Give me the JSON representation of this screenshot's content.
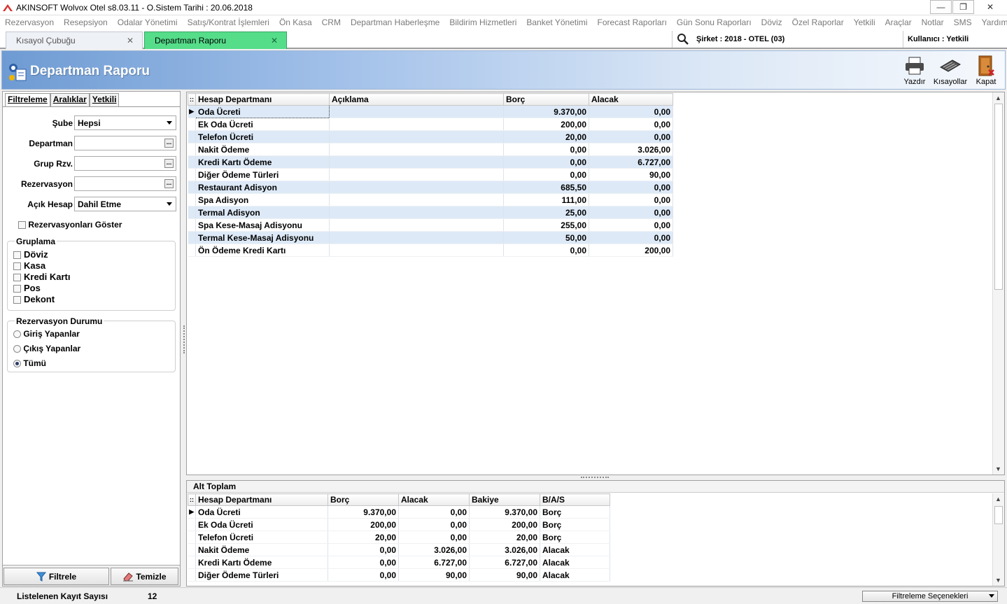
{
  "window": {
    "title": "AKINSOFT Wolvox Otel s8.03.11 - O.Sistem Tarihi : 20.06.2018",
    "minimize": "—",
    "maximize": "❐",
    "close": "✕"
  },
  "menu": [
    "Rezervasyon",
    "Resepsiyon",
    "Odalar Yönetimi",
    "Satış/Kontrat İşlemleri",
    "Ön Kasa",
    "CRM",
    "Departman Haberleşme",
    "Bildirim Hizmetleri",
    "Banket Yönetimi",
    "Forecast Raporları",
    "Gün Sonu Raporları",
    "Döviz",
    "Özel Raporlar",
    "Yetkili",
    "Araçlar",
    "Notlar",
    "SMS",
    "Yardım"
  ],
  "tabs": [
    {
      "label": "Kısayol Çubuğu",
      "active": false
    },
    {
      "label": "Departman Raporu",
      "active": true
    }
  ],
  "company": "Şirket : 2018 - OTEL (03)",
  "user": "Kullanıcı : Yetkili",
  "header": {
    "title": "Departman Raporu",
    "print_label": "Yazdır",
    "shortcuts_label": "Kısayollar",
    "close_label": "Kapat"
  },
  "filter_tabs": [
    "Filtreleme",
    "Aralıklar",
    "Yetkili"
  ],
  "filters": {
    "sube_label": "Şube",
    "sube_value": "Hepsi",
    "departman_label": "Departman",
    "departman_value": "",
    "grup_label": "Grup Rzv.",
    "grup_value": "",
    "rezervasyon_label": "Rezervasyon",
    "rezervasyon_value": "",
    "acik_hesap_label": "Açık Hesap",
    "acik_hesap_value": "Dahil Etme",
    "show_reservations_label": "Rezervasyonları Göster"
  },
  "grouping": {
    "title": "Gruplama",
    "items": [
      "Döviz",
      "Kasa",
      "Kredi Kartı",
      "Pos",
      "Dekont"
    ]
  },
  "reservation_status": {
    "title": "Rezervasyon Durumu",
    "options": [
      "Giriş Yapanlar",
      "Çıkış Yapanlar",
      "Tümü"
    ],
    "selected": "Tümü"
  },
  "buttons": {
    "filter": "Filtrele",
    "clear": "Temizle"
  },
  "main_grid": {
    "columns": [
      "Hesap Departmanı",
      "Açıklama",
      "Borç",
      "Alacak"
    ],
    "rows": [
      [
        "Oda Ücreti",
        "",
        "9.370,00",
        "0,00"
      ],
      [
        "Ek Oda Ücreti",
        "",
        "200,00",
        "0,00"
      ],
      [
        "Telefon Ücreti",
        "",
        "20,00",
        "0,00"
      ],
      [
        "Nakit Ödeme",
        "",
        "0,00",
        "3.026,00"
      ],
      [
        "Kredi Kartı Ödeme",
        "",
        "0,00",
        "6.727,00"
      ],
      [
        "Diğer Ödeme Türleri",
        "",
        "0,00",
        "90,00"
      ],
      [
        "Restaurant Adisyon",
        "",
        "685,50",
        "0,00"
      ],
      [
        "Spa Adisyon",
        "",
        "111,00",
        "0,00"
      ],
      [
        "Termal Adisyon",
        "",
        "25,00",
        "0,00"
      ],
      [
        "Spa Kese-Masaj Adisyonu",
        "",
        "255,00",
        "0,00"
      ],
      [
        "Termal Kese-Masaj Adisyonu",
        "",
        "50,00",
        "0,00"
      ],
      [
        "Ön Ödeme Kredi Kartı",
        "",
        "0,00",
        "200,00"
      ]
    ]
  },
  "subtotal": {
    "title": "Alt Toplam",
    "columns": [
      "Hesap Departmanı",
      "Borç",
      "Alacak",
      "Bakiye",
      "B/A/S"
    ],
    "rows": [
      [
        "Oda Ücreti",
        "9.370,00",
        "0,00",
        "9.370,00",
        "Borç"
      ],
      [
        "Ek Oda Ücreti",
        "200,00",
        "0,00",
        "200,00",
        "Borç"
      ],
      [
        "Telefon Ücreti",
        "20,00",
        "0,00",
        "20,00",
        "Borç"
      ],
      [
        "Nakit Ödeme",
        "0,00",
        "3.026,00",
        "3.026,00",
        "Alacak"
      ],
      [
        "Kredi Kartı Ödeme",
        "0,00",
        "6.727,00",
        "6.727,00",
        "Alacak"
      ],
      [
        "Diğer Ödeme Türleri",
        "0,00",
        "90,00",
        "90,00",
        "Alacak"
      ]
    ]
  },
  "status": {
    "record_count_label": "Listelenen Kayıt Sayısı",
    "record_count": "12",
    "filter_options_label": "Filtreleme Seçenekleri"
  },
  "colors": {
    "active_tab": "#55dd8a",
    "banner_start": "#6e9bd3",
    "alt_row": "#dde9f7"
  }
}
